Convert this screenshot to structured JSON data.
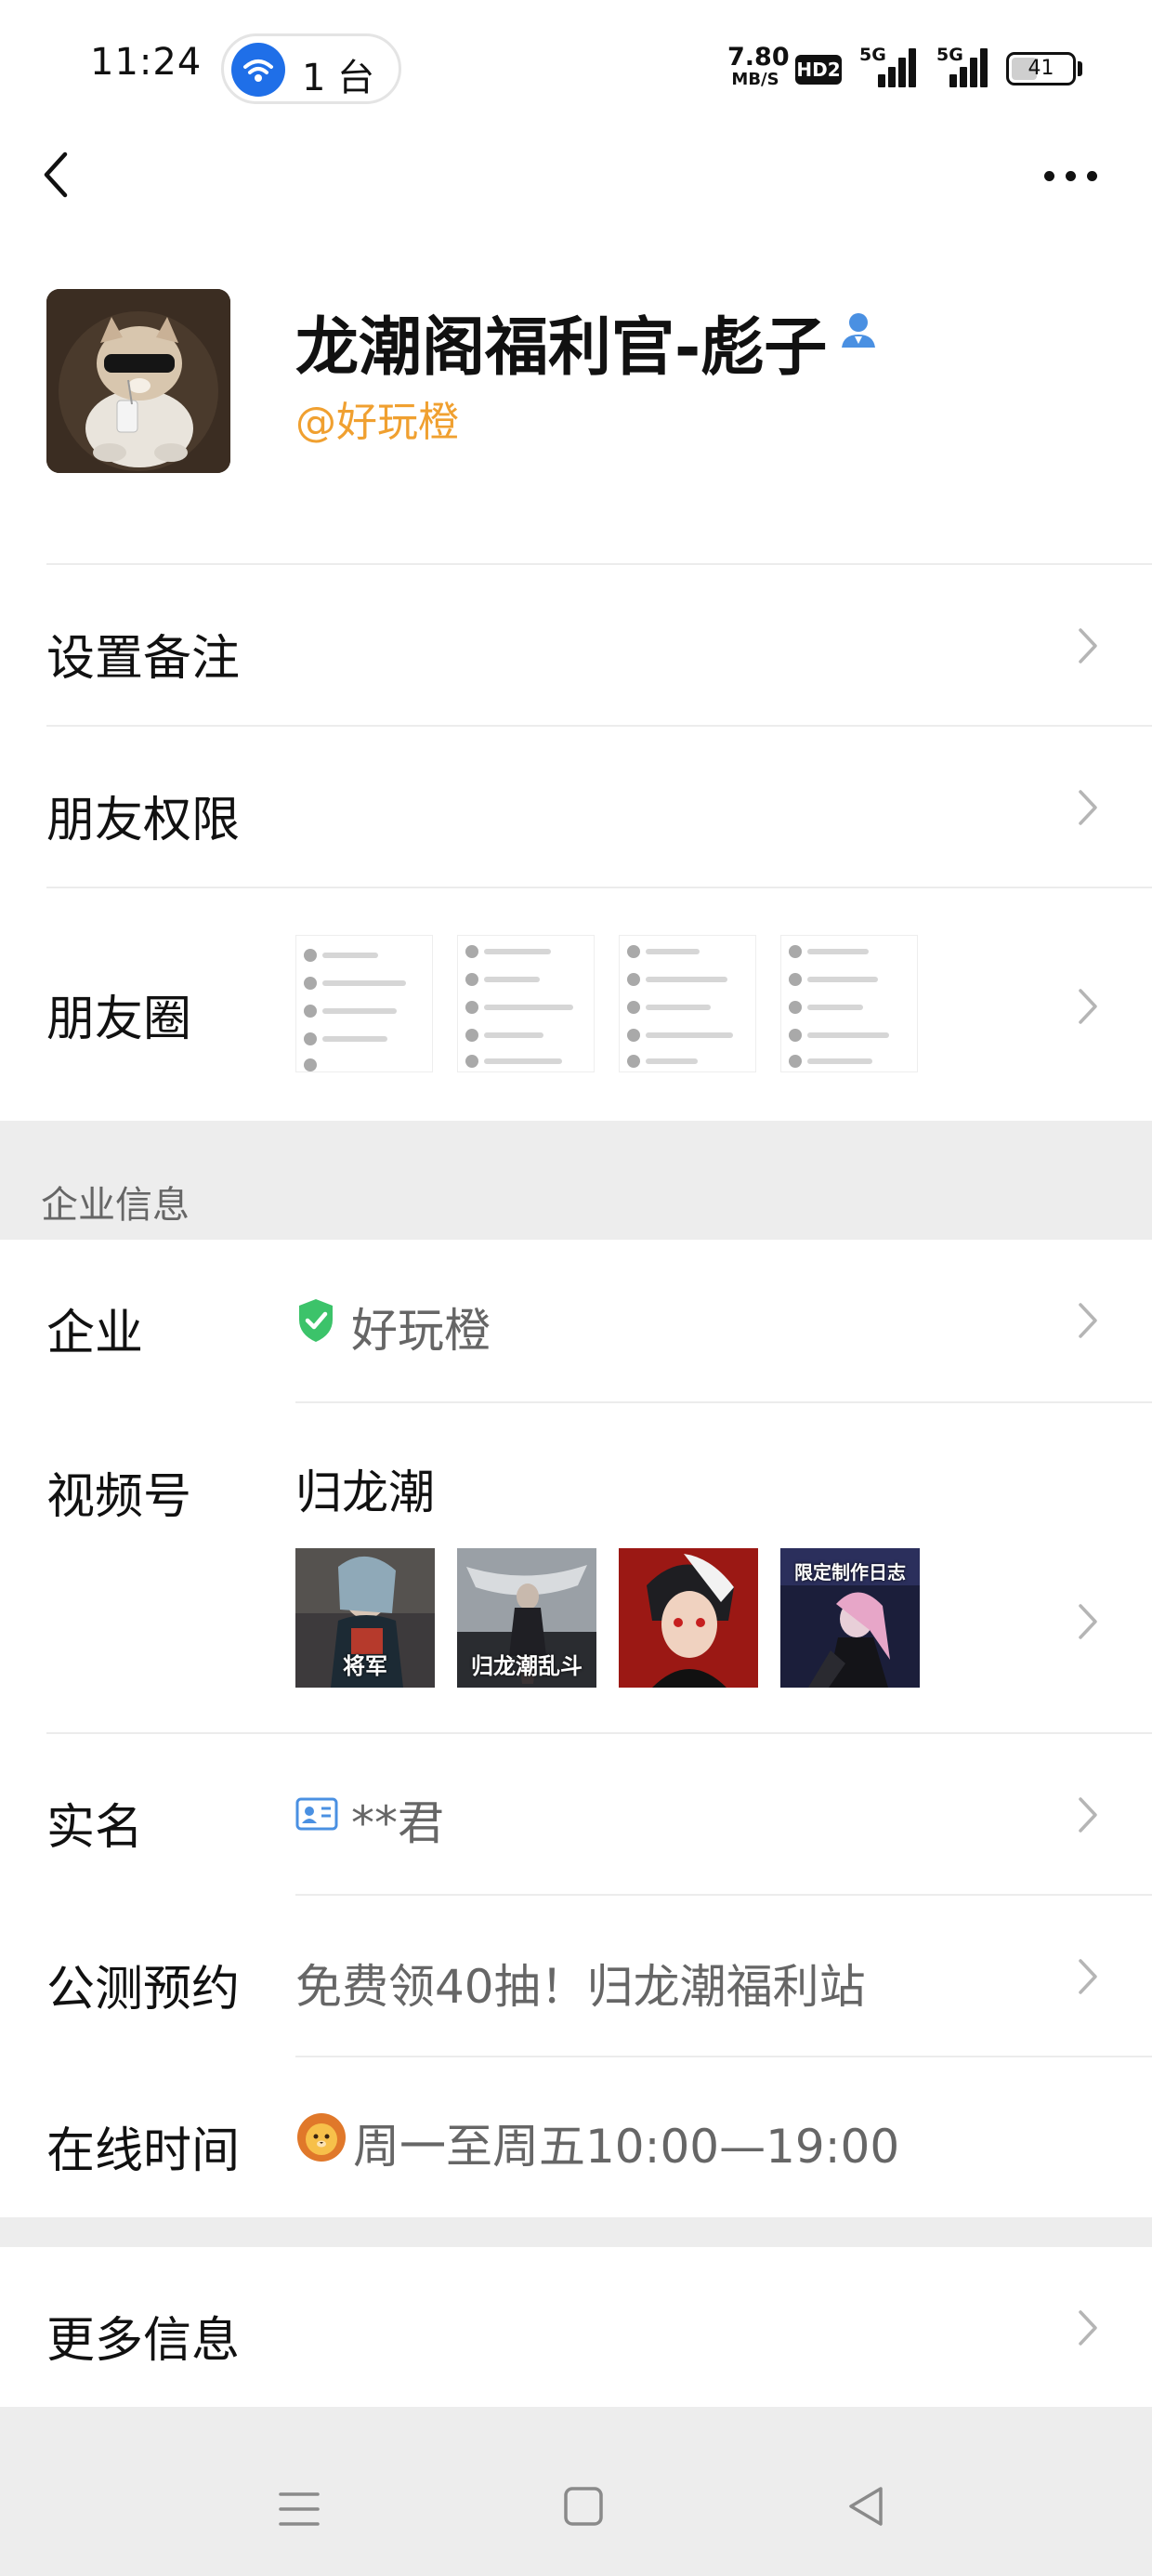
{
  "status_bar": {
    "time": "11:24",
    "pill_count": "1 台",
    "net_speed_value": "7.80",
    "net_speed_unit": "MB/S",
    "hd_badge": "HD2",
    "signal_1_tag": "5G",
    "signal_2_tag": "5G",
    "battery_level": "41",
    "battery_fraction": 0.41
  },
  "nav": {
    "back_icon": "chevron-left-icon",
    "more_icon": "more-dots-icon"
  },
  "profile": {
    "name": "龙潮阁福利官-彪子",
    "handle": "@好玩橙",
    "badge_icon": "person-verified-icon"
  },
  "rows": {
    "set_remark": "设置备注",
    "friend_permissions": "朋友权限",
    "moments": "朋友圈"
  },
  "enterprise_section": {
    "title": "企业信息",
    "company_label": "企业",
    "company_value": "好玩橙",
    "channels_label": "视频号",
    "channels_value": "归龙潮",
    "channel_thumb_captions": [
      "将军",
      "归龙潮乱斗",
      "",
      "限定制作日志"
    ],
    "realname_label": "实名",
    "realname_value": "**君",
    "preorder_label": "公测预约",
    "preorder_value": "免费领40抽！归龙潮福利站",
    "online_label": "在线时间",
    "online_value": "周一至周五10:00—19:00"
  },
  "more_info": {
    "label": "更多信息"
  },
  "colors": {
    "accent_orange": "#f0a030",
    "verified_green": "#3cc36a",
    "badge_blue": "#4a90e2",
    "section_gray": "#ededed"
  }
}
